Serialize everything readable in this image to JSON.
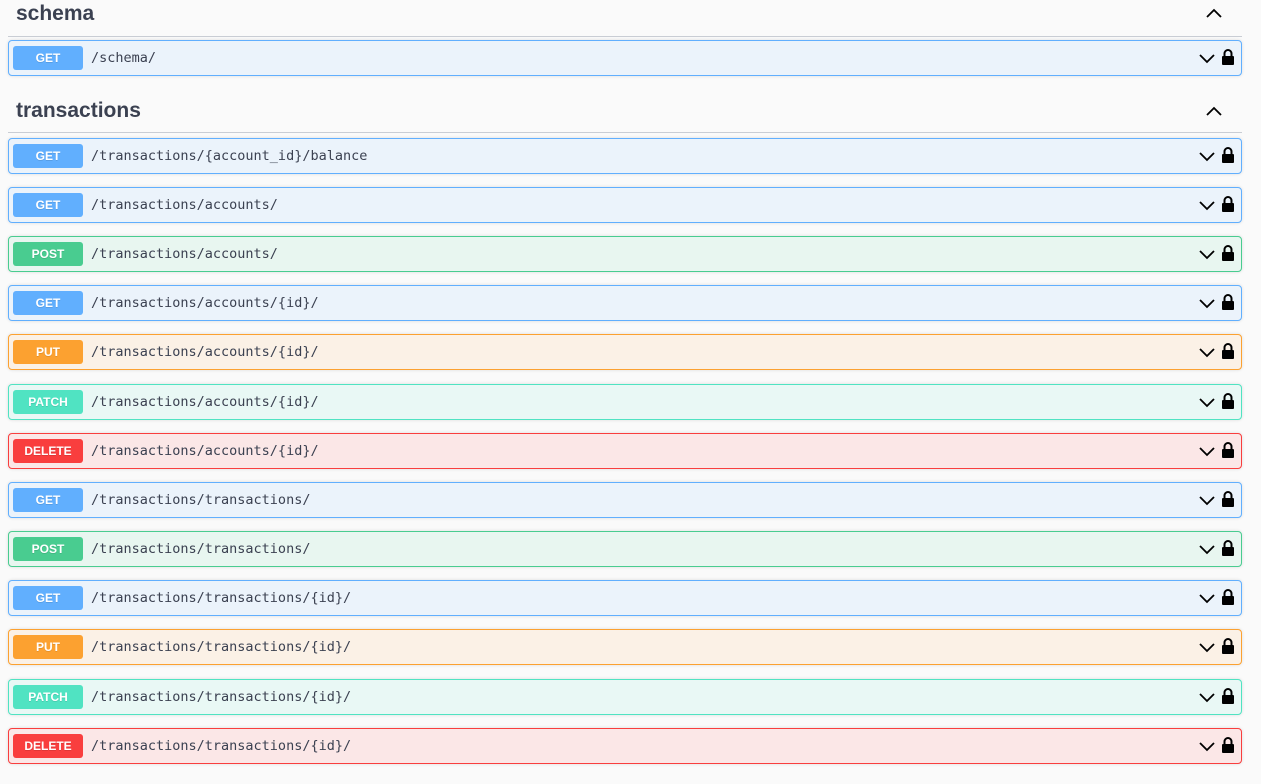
{
  "sections": [
    {
      "title": "schema",
      "operations": [
        {
          "method": "GET",
          "path": "/schema/"
        }
      ]
    },
    {
      "title": "transactions",
      "operations": [
        {
          "method": "GET",
          "path": "/transactions/{account_id}/balance"
        },
        {
          "method": "GET",
          "path": "/transactions/accounts/"
        },
        {
          "method": "POST",
          "path": "/transactions/accounts/"
        },
        {
          "method": "GET",
          "path": "/transactions/accounts/{id}/"
        },
        {
          "method": "PUT",
          "path": "/transactions/accounts/{id}/"
        },
        {
          "method": "PATCH",
          "path": "/transactions/accounts/{id}/"
        },
        {
          "method": "DELETE",
          "path": "/transactions/accounts/{id}/"
        },
        {
          "method": "GET",
          "path": "/transactions/transactions/"
        },
        {
          "method": "POST",
          "path": "/transactions/transactions/"
        },
        {
          "method": "GET",
          "path": "/transactions/transactions/{id}/"
        },
        {
          "method": "PUT",
          "path": "/transactions/transactions/{id}/"
        },
        {
          "method": "PATCH",
          "path": "/transactions/transactions/{id}/"
        },
        {
          "method": "DELETE",
          "path": "/transactions/transactions/{id}/"
        }
      ]
    }
  ],
  "icons": {
    "collapse": "chevron-up-icon",
    "expand": "chevron-down-icon",
    "auth": "lock-icon"
  },
  "colors": {
    "GET": "#61affe",
    "POST": "#49cc90",
    "PUT": "#fca130",
    "PATCH": "#50e3c2",
    "DELETE": "#f93e3e"
  }
}
